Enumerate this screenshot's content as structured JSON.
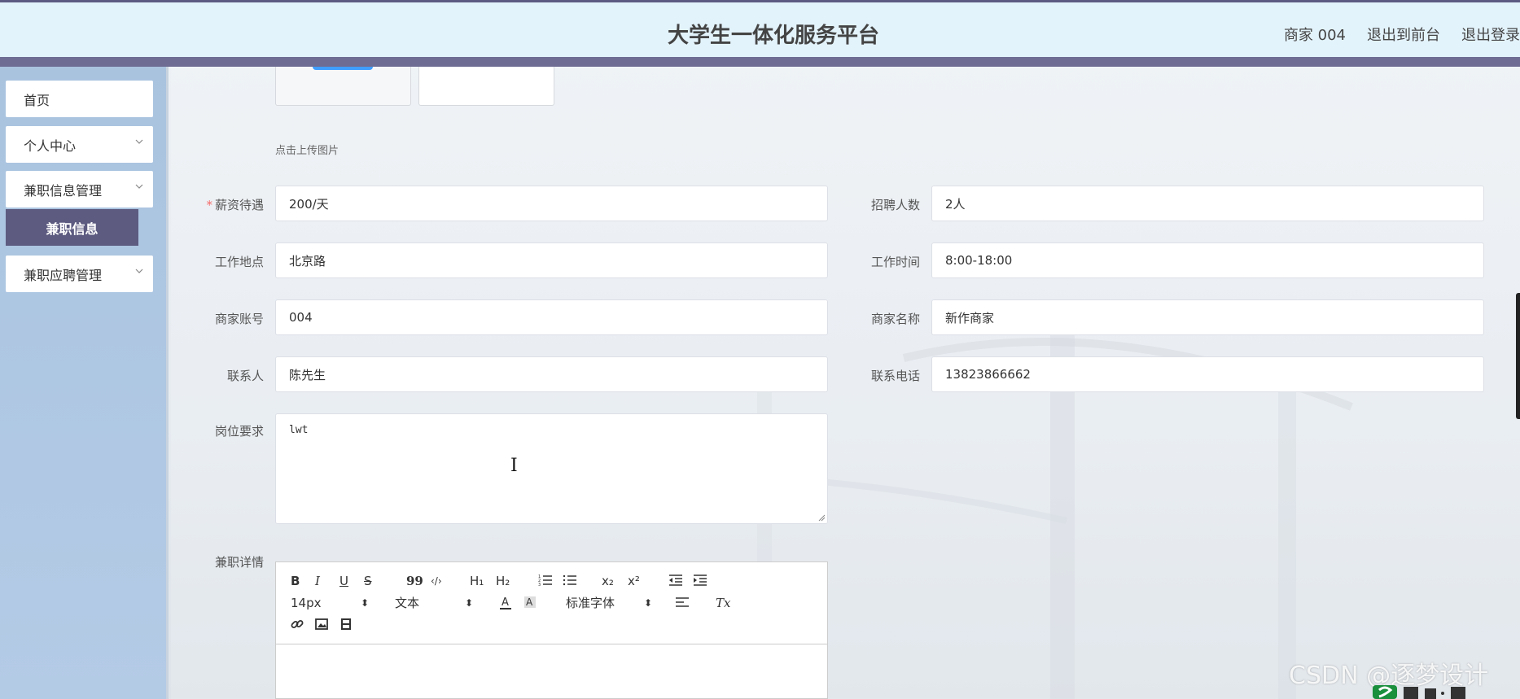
{
  "header": {
    "title": "大学生一体化服务平台",
    "user_label": "商家 004",
    "back_to_front": "退出到前台",
    "logout": "退出登录"
  },
  "sidebar": {
    "items": [
      {
        "label": "首页"
      },
      {
        "label": "个人中心"
      },
      {
        "label": "兼职信息管理"
      },
      {
        "label": "兼职应聘管理"
      }
    ],
    "active_sub": "兼职信息"
  },
  "upload": {
    "hint": "点击上传图片"
  },
  "form": {
    "salary": {
      "label": "薪资待遇",
      "value": "200/天"
    },
    "headcount": {
      "label": "招聘人数",
      "value": "2人"
    },
    "location": {
      "label": "工作地点",
      "value": "北京路"
    },
    "work_time": {
      "label": "工作时间",
      "value": "8:00-18:00"
    },
    "merchant_account": {
      "label": "商家账号",
      "value": "004"
    },
    "merchant_name": {
      "label": "商家名称",
      "value": "新作商家"
    },
    "contact": {
      "label": "联系人",
      "value": "陈先生"
    },
    "phone": {
      "label": "联系电话",
      "value": "13823866662"
    },
    "requirements": {
      "label": "岗位要求",
      "value": "lwt"
    },
    "details": {
      "label": "兼职详情"
    }
  },
  "editor": {
    "bold": "B",
    "italic": "I",
    "underline": "U",
    "strike": "S",
    "quote": "99",
    "code": "‹/›",
    "h1": "H₁",
    "h2": "H₂",
    "sub": "x₂",
    "sup": "x²",
    "size": "14px",
    "size_arrow": "⬍",
    "format": "文本",
    "format_arrow": "⬍",
    "font": "标准字体",
    "font_arrow": "⬍",
    "clear": "Tx"
  },
  "watermark": "CSDN @逐梦设计",
  "colors": {
    "accent": "#5d5b80",
    "header_bg": "#e3f3fb",
    "sidebar_bg": "#b4cbe6",
    "required": "#f56c6c"
  }
}
